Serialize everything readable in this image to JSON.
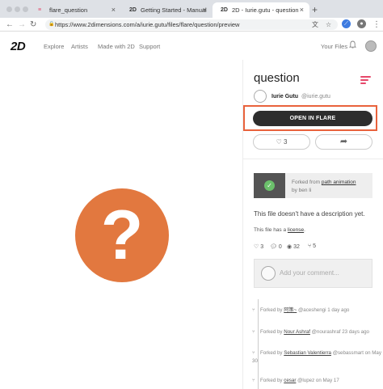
{
  "browser": {
    "tabs": [
      {
        "title": "flare_question",
        "favicon": "flare-icon",
        "active": false
      },
      {
        "title": "Getting Started - Manual",
        "favicon": "2d-icon",
        "active": false
      },
      {
        "title": "2D - Iurie.gutu - question",
        "favicon": "2d-icon",
        "active": true
      }
    ],
    "url": "https://www.2dimensions.com/a/iurie.gutu/files/flare/question/preview"
  },
  "header": {
    "logo": "2D",
    "nav": [
      "Explore",
      "Artists",
      "Made with 2D",
      "Support"
    ],
    "your_files": "Your Files"
  },
  "file": {
    "title": "question",
    "author_name": "Iurie Gutu",
    "author_handle": "@iurie.gutu",
    "open_button": "OPEN IN FLARE",
    "likes": "3",
    "forked_prefix": "Forked from",
    "forked_from": "path animation",
    "forked_by": "by ben li",
    "description": "This file doesn't have a description yet.",
    "license_prefix": "This file has a",
    "license_link": "license",
    "license_suffix": "."
  },
  "stats": {
    "likes": "3",
    "comments": "0",
    "views": "32",
    "forks": "5"
  },
  "comment_placeholder": "Add your comment...",
  "forks": [
    {
      "prefix": "Forked by",
      "name": "阿策~",
      "rest": "@aceshengi 1 day ago"
    },
    {
      "prefix": "Forked by",
      "name": "Nour Ashraf",
      "rest": "@nourashraf 23 days ago"
    },
    {
      "prefix": "Forked by",
      "name": "Sebastian Valentierra",
      "rest": "@sebassmart on May 30"
    },
    {
      "prefix": "Forked by",
      "name": "cesar",
      "rest": "@lupez on May 17"
    }
  ],
  "colors": {
    "accent": "#e9623c",
    "preview_circle": "#e2783f",
    "brand_pink": "#e6486a"
  },
  "preview_glyph": "?"
}
